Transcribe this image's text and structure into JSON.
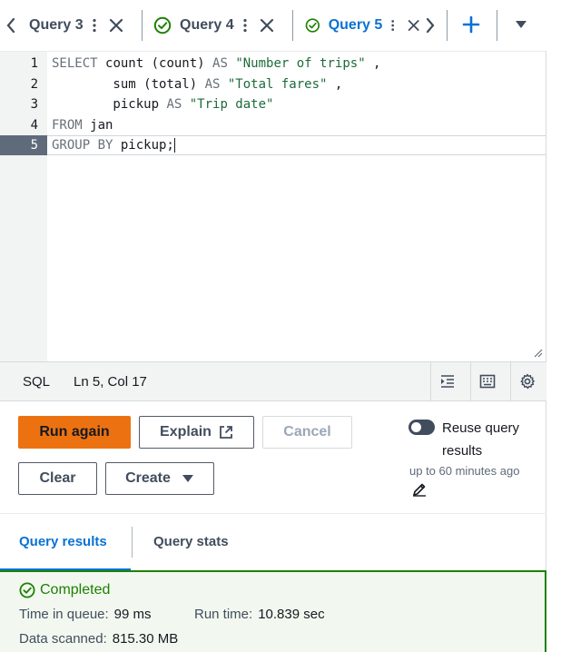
{
  "tabs": [
    {
      "label": "Query 3",
      "status": "none"
    },
    {
      "label": "Query 4",
      "status": "completed"
    },
    {
      "label": "Query 5",
      "status": "completed",
      "active": true
    }
  ],
  "editor": {
    "lines": [
      {
        "n": "1",
        "tokens": [
          {
            "t": "SELECT ",
            "c": "kw"
          },
          {
            "t": "count (count) ",
            "c": "plain"
          },
          {
            "t": "AS ",
            "c": "kw"
          },
          {
            "t": "\"Number of trips\"",
            "c": "str"
          },
          {
            "t": " ,",
            "c": "plain"
          }
        ]
      },
      {
        "n": "2",
        "tokens": [
          {
            "t": "        sum (total) ",
            "c": "plain"
          },
          {
            "t": "AS ",
            "c": "kw"
          },
          {
            "t": "\"Total fares\"",
            "c": "str"
          },
          {
            "t": " ,",
            "c": "plain"
          }
        ]
      },
      {
        "n": "3",
        "tokens": [
          {
            "t": "        pickup ",
            "c": "plain"
          },
          {
            "t": "AS ",
            "c": "kw"
          },
          {
            "t": "\"Trip date\"",
            "c": "str"
          }
        ]
      },
      {
        "n": "4",
        "tokens": [
          {
            "t": "FROM ",
            "c": "kw"
          },
          {
            "t": "jan",
            "c": "plain"
          }
        ]
      },
      {
        "n": "5",
        "tokens": [
          {
            "t": "GROUP BY ",
            "c": "kw"
          },
          {
            "t": "pickup;",
            "c": "plain"
          }
        ],
        "current": true
      }
    ]
  },
  "status": {
    "language": "SQL",
    "position": "Ln 5, Col 17"
  },
  "actions": {
    "run_again": "Run again",
    "explain": "Explain",
    "cancel": "Cancel",
    "clear": "Clear",
    "create": "Create",
    "reuse_label": "Reuse query results",
    "reuse_desc": "up to 60 minutes ago"
  },
  "result_tabs": {
    "results": "Query results",
    "stats": "Query stats"
  },
  "result": {
    "status": "Completed",
    "queue_label": "Time in queue:",
    "queue_value": "99 ms",
    "run_label": "Run time:",
    "run_value": "10.839 sec",
    "scanned_label": "Data scanned:",
    "scanned_value": "815.30 MB"
  },
  "colors": {
    "accent": "#0972d3",
    "primary_button": "#ec7211",
    "success": "#1d8102"
  }
}
